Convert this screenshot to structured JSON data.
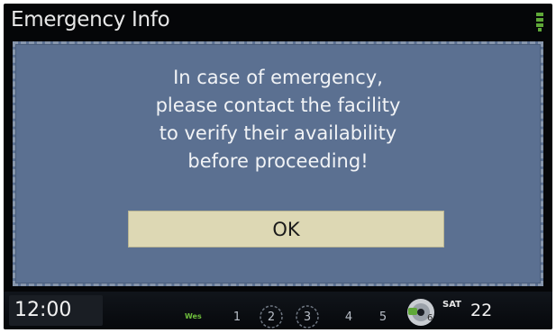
{
  "header": {
    "title": "Emergency Info",
    "status_icon": "antenna-signal-icon"
  },
  "dialog": {
    "message": "In case of emergency,\nplease contact the facility\nto verify their availability\nbefore proceeding!",
    "ok_label": "OK"
  },
  "statusbar": {
    "clock": "12:00",
    "source_label": "Wes",
    "presets": [
      {
        "label": "1"
      },
      {
        "label": "2"
      },
      {
        "label": "3"
      },
      {
        "label": "4"
      },
      {
        "label": "5"
      }
    ],
    "band": "SAT",
    "channel": "22",
    "disc_icon": "disc-icon"
  },
  "colors": {
    "panel": "#5b7091",
    "button": "#ddd8b4",
    "background": "#050608",
    "title_text": "#e8e8e8"
  }
}
